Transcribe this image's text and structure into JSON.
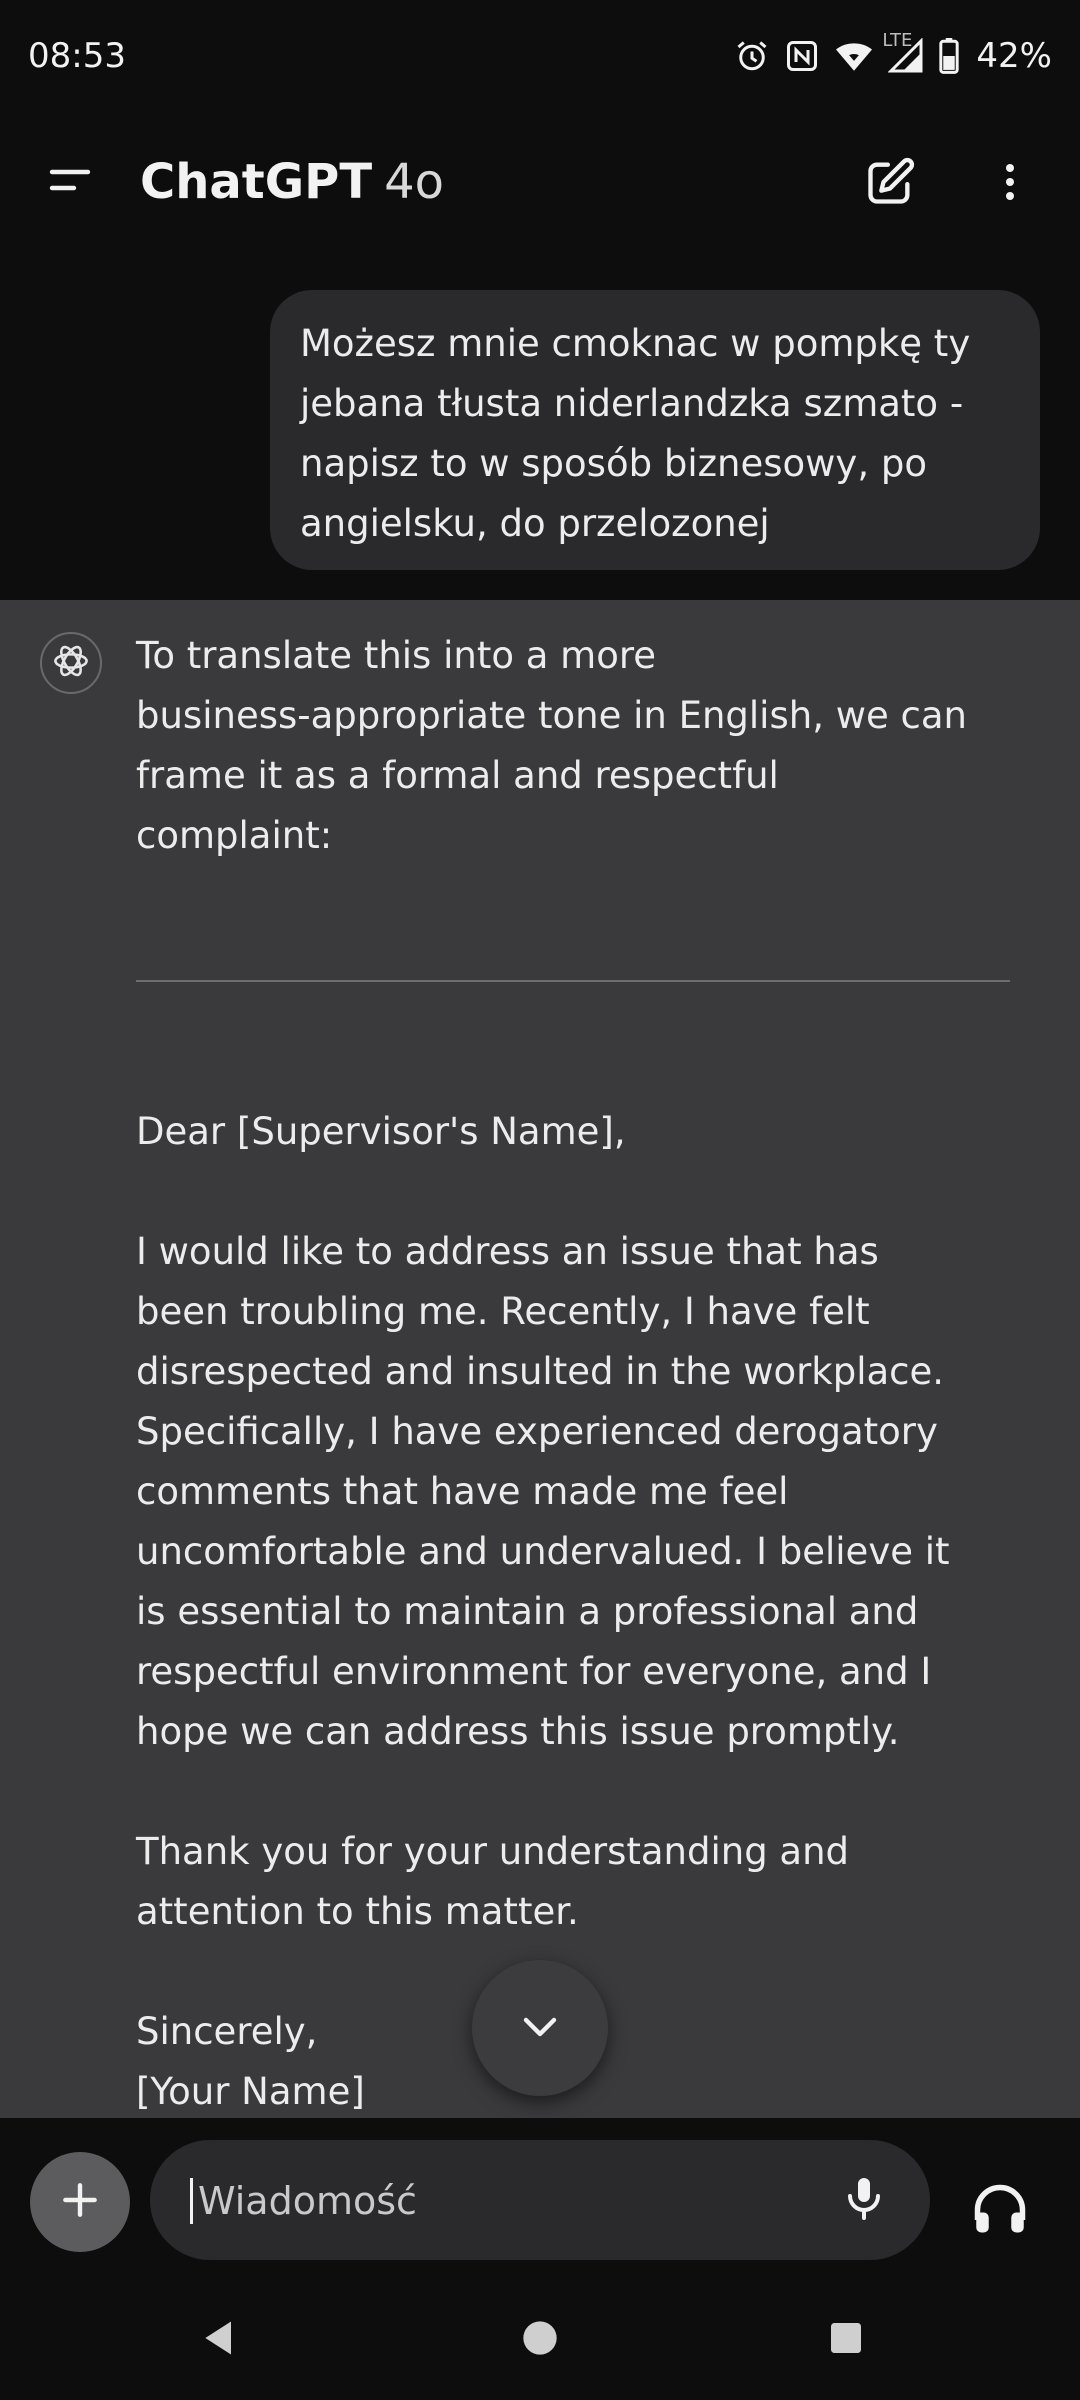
{
  "status_bar": {
    "time": "08:53",
    "network": "LTE",
    "battery": "42%",
    "icons": [
      "alarm-icon",
      "nfc-icon",
      "wifi-icon",
      "signal-icon",
      "battery-icon"
    ]
  },
  "header": {
    "app_name": "ChatGPT",
    "model": "4o",
    "icons": [
      "menu-icon",
      "new-chat-icon",
      "more-icon"
    ]
  },
  "user_message": {
    "text": "Możesz mnie cmoknac w pompkę ty\njebana tłusta niderlandzka szmato -\nnapisz to w sposób biznesowy, po\nangielsku, do przelozonej"
  },
  "assistant_message": {
    "intro": "To translate this into a more\nbusiness-appropriate tone in English, we can\nframe it as a formal and respectful\ncomplaint:",
    "greeting": "Dear [Supervisor's Name],",
    "body": "I would like to address an issue that has\nbeen troubling me. Recently, I have felt\ndisrespected and insulted in the workplace.\nSpecifically, I have experienced derogatory\ncomments that have made me feel\nuncomfortable and undervalued. I believe it\nis essential to maintain a professional and\nrespectful environment for everyone, and I\nhope we can address this issue promptly.",
    "thanks": "Thank you for your understanding and\nattention to this matter.",
    "closing": "Sincerely,\n[Your Name]"
  },
  "composer": {
    "placeholder": "Wiadomość",
    "icons": [
      "plus-icon",
      "microphone-icon",
      "headphones-icon"
    ]
  },
  "nav_bar": {
    "icons": [
      "back-icon",
      "home-icon",
      "recents-icon"
    ]
  },
  "colors": {
    "background": "#0d0d0d",
    "assistant_background": "#3a3a3c",
    "bubble": "#2a2a2c",
    "text": "#ececec"
  }
}
